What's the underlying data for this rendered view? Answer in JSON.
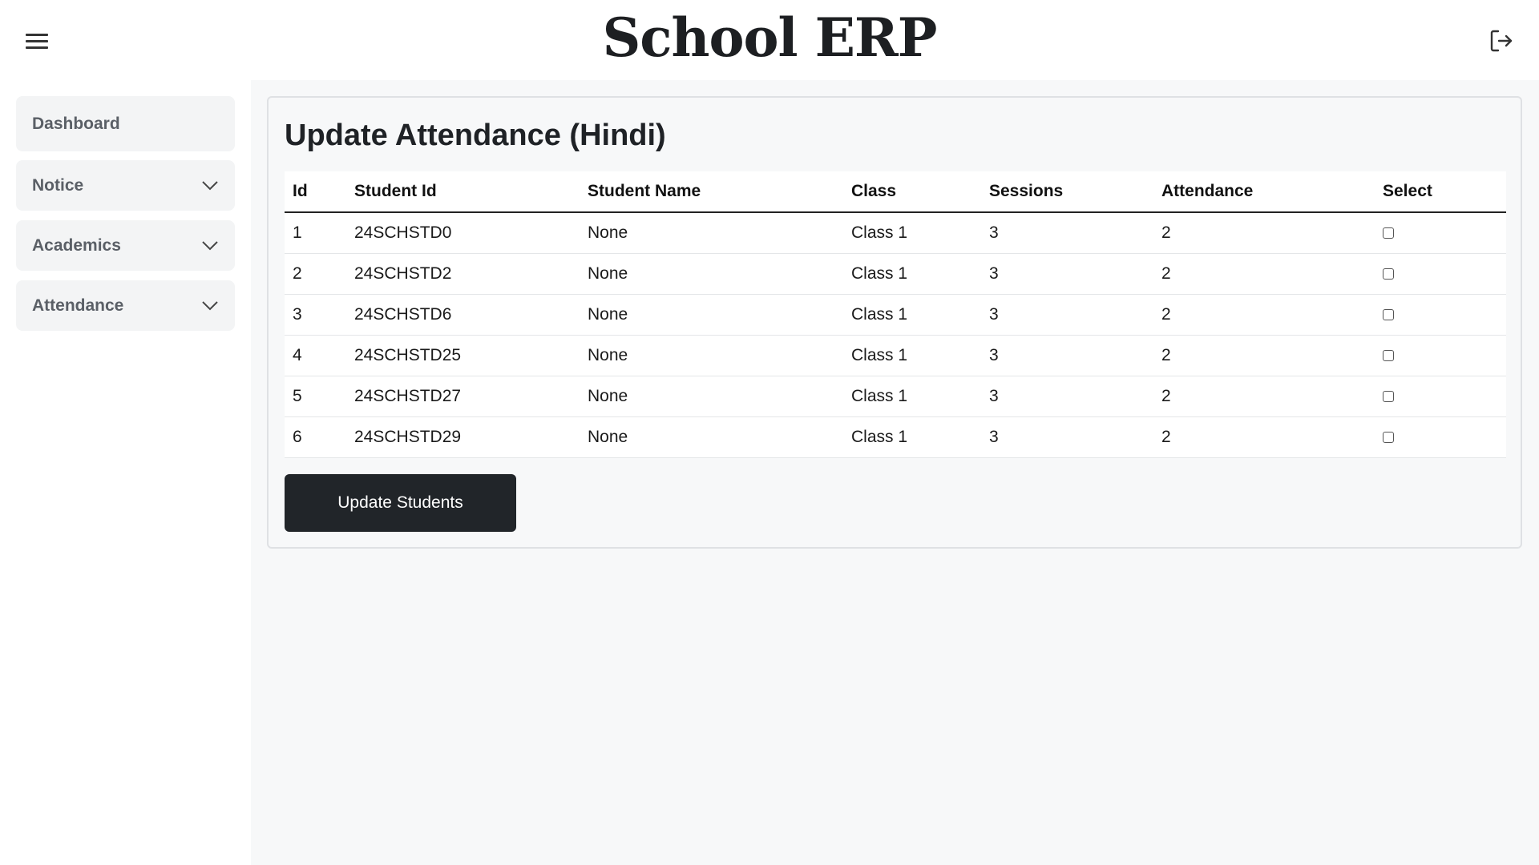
{
  "header": {
    "title": "School ERP",
    "menu_icon": "hamburger-menu-icon",
    "logout_icon": "logout-icon"
  },
  "sidebar": {
    "items": [
      {
        "label": "Dashboard",
        "has_chevron": false
      },
      {
        "label": "Notice",
        "has_chevron": true
      },
      {
        "label": "Academics",
        "has_chevron": true
      },
      {
        "label": "Attendance",
        "has_chevron": true
      }
    ]
  },
  "main": {
    "title": "Update Attendance (Hindi)",
    "table": {
      "columns": [
        "Id",
        "Student Id",
        "Student Name",
        "Class",
        "Sessions",
        "Attendance",
        "Select"
      ],
      "rows": [
        [
          "1",
          "24SCHSTD0",
          "None",
          "Class 1",
          "3",
          "2"
        ],
        [
          "2",
          "24SCHSTD2",
          "None",
          "Class 1",
          "3",
          "2"
        ],
        [
          "3",
          "24SCHSTD6",
          "None",
          "Class 1",
          "3",
          "2"
        ],
        [
          "4",
          "24SCHSTD25",
          "None",
          "Class 1",
          "3",
          "2"
        ],
        [
          "5",
          "24SCHSTD27",
          "None",
          "Class 1",
          "3",
          "2"
        ],
        [
          "6",
          "24SCHSTD29",
          "None",
          "Class 1",
          "3",
          "2"
        ]
      ]
    },
    "update_button": "Update Students"
  }
}
